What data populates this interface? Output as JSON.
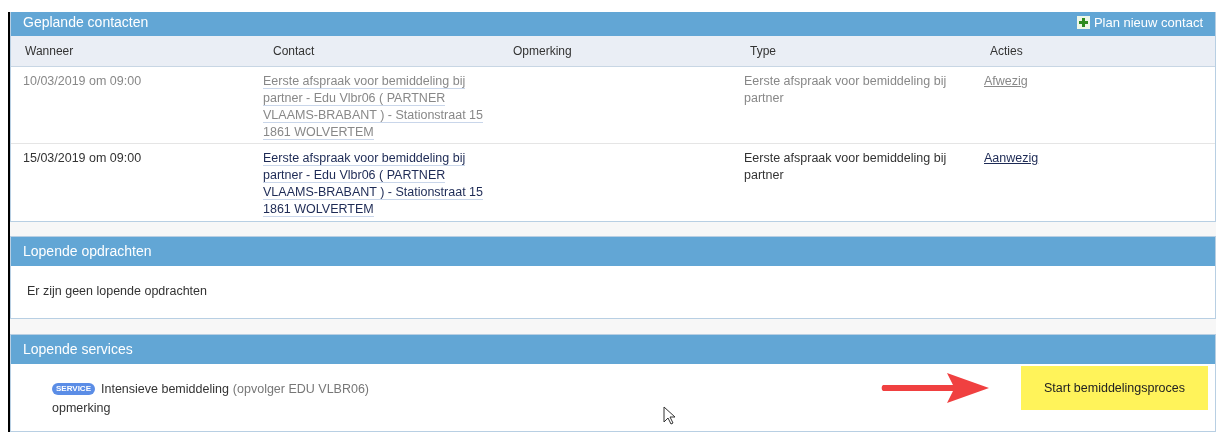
{
  "contacts_panel": {
    "title": "Geplande contacten",
    "action": "Plan nieuw contact",
    "columns": [
      "Wanneer",
      "Contact",
      "Opmerking",
      "Type",
      "Acties"
    ],
    "rows": [
      {
        "when": "10/03/2019 om 09:00",
        "contact": "Eerste afspraak voor bemiddeling bij partner - Edu Vlbr06 ( PARTNER VLAAMS-BRABANT ) - Stationstraat 15 1861 WOLVERTEM",
        "type": "Eerste afspraak voor bemiddeling bij partner",
        "action": "Afwezig",
        "past": true
      },
      {
        "when": "15/03/2019 om 09:00",
        "contact": "Eerste afspraak voor bemiddeling bij partner - Edu Vlbr06 ( PARTNER VLAAMS-BRABANT ) - Stationstraat 15 1861 WOLVERTEM",
        "type": "Eerste afspraak voor bemiddeling bij partner",
        "action": "Aanwezig",
        "past": false
      }
    ]
  },
  "assignments_panel": {
    "title": "Lopende opdrachten",
    "empty_message": "Er zijn geen lopende opdrachten"
  },
  "services_panel": {
    "title": "Lopende services",
    "services": [
      {
        "badge": "SERVICE",
        "name": "Intensieve bemiddeling",
        "detail": "(opvolger EDU VLBR06)",
        "remark": "opmerking"
      }
    ],
    "button": "Start bemiddelingsproces"
  }
}
